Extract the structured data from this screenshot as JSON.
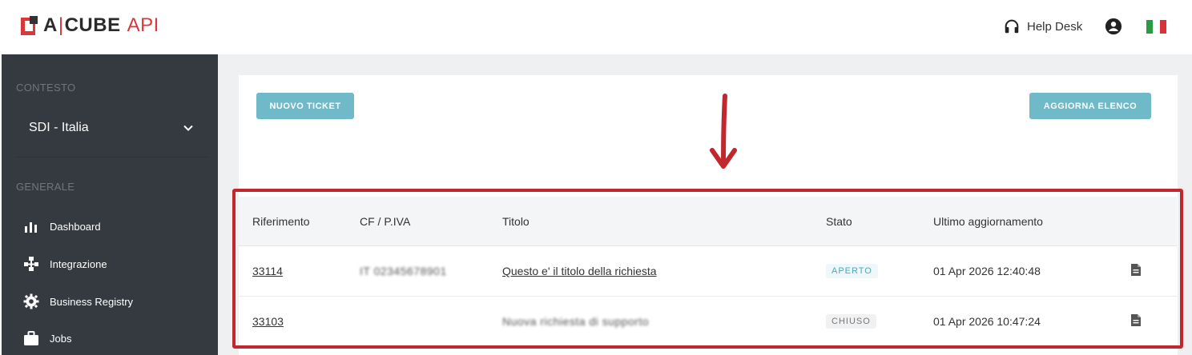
{
  "header": {
    "logo_a": "A",
    "logo_sep": "|",
    "logo_cube": "CUBE",
    "logo_api": "API",
    "helpdesk_label": "Help Desk",
    "user_icon": "user-circle-icon",
    "language_flag": "italy-flag"
  },
  "sidebar": {
    "context_label": "CONTESTO",
    "context_value": "SDI - Italia",
    "general_label": "GENERALE",
    "items": [
      {
        "label": "Dashboard",
        "icon": "bar-chart-icon"
      },
      {
        "label": "Integrazione",
        "icon": "network-icon"
      },
      {
        "label": "Business Registry",
        "icon": "gear-icon"
      },
      {
        "label": "Jobs",
        "icon": "briefcase-icon"
      }
    ]
  },
  "toolbar": {
    "new_ticket_label": "NUOVO TICKET",
    "refresh_label": "AGGIORNA ELENCO"
  },
  "table": {
    "columns": [
      "Riferimento",
      "CF / P.IVA",
      "Titolo",
      "Stato",
      "Ultimo aggiornamento"
    ],
    "rows": [
      {
        "ref": "33114",
        "cf": "IT 02345678901",
        "title": "Questo e' il titolo della richiesta",
        "status": "APERTO",
        "updated": "01 Apr 2026 12:40:48"
      },
      {
        "ref": "33103",
        "cf": "",
        "title": "Nuova richiesta di supporto",
        "status": "CHIUSO",
        "updated": "01 Apr 2026 10:47:24"
      }
    ]
  },
  "colors": {
    "brand_red": "#d9383a",
    "button_teal": "#6fb9c9",
    "sidebar_bg": "#353a40",
    "highlight_red": "#c1272d"
  }
}
